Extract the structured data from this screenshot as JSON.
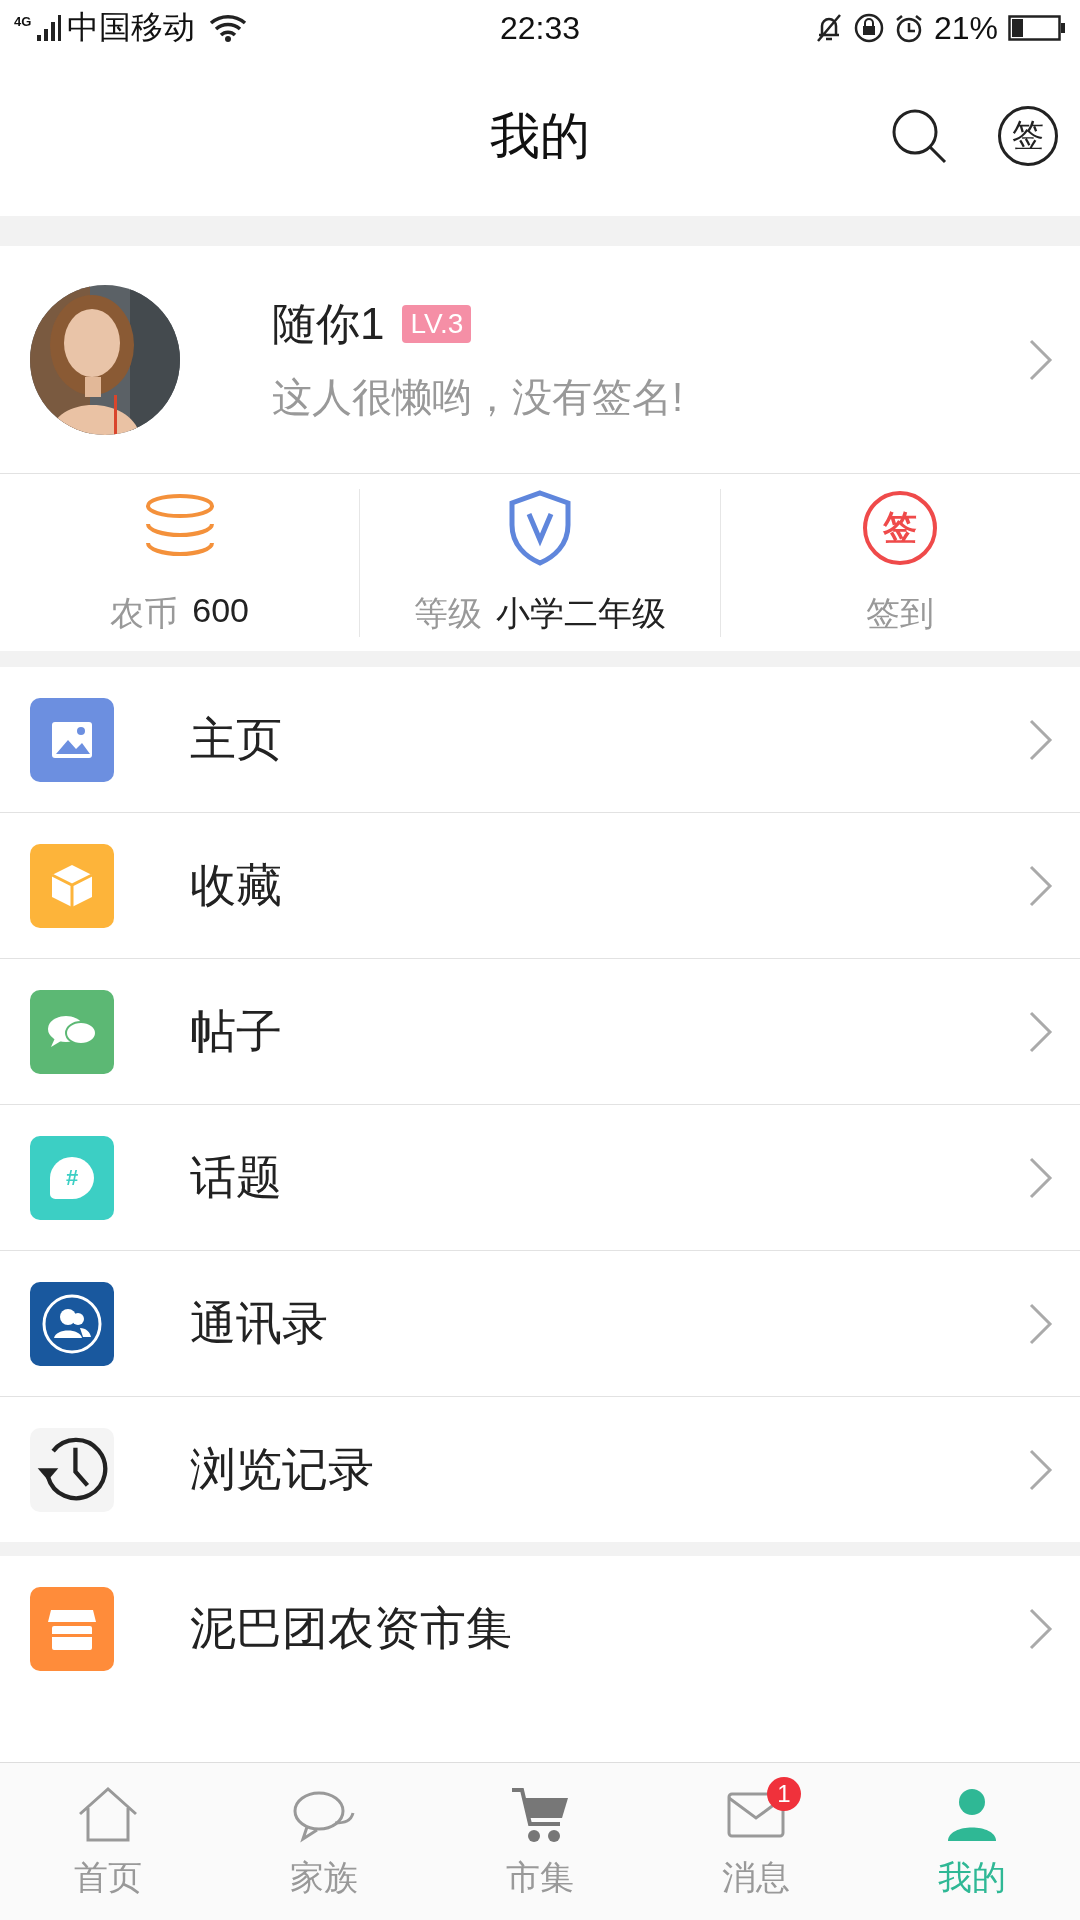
{
  "status_bar": {
    "network": "4G",
    "carrier": "中国移动",
    "time": "22:33",
    "battery": "21%"
  },
  "header": {
    "title": "我的",
    "sign_glyph": "签"
  },
  "profile": {
    "name": "随你1",
    "level_badge": "LV.3",
    "signature": "这人很懒哟，没有签名!"
  },
  "stats": [
    {
      "kind": "coins",
      "label": "农币",
      "value": "600"
    },
    {
      "kind": "grade",
      "label": "等级",
      "value": "小学二年级"
    },
    {
      "kind": "sign",
      "label": "签到",
      "glyph": "签"
    }
  ],
  "menu_groups": [
    {
      "items": [
        {
          "label": "主页"
        },
        {
          "label": "收藏"
        },
        {
          "label": "帖子"
        },
        {
          "label": "话题",
          "glyph": "#"
        },
        {
          "label": "通讯录"
        },
        {
          "label": "浏览记录"
        }
      ]
    },
    {
      "items": [
        {
          "label": "泥巴团农资市集"
        }
      ]
    }
  ],
  "tab_bar": [
    {
      "label": "首页",
      "selected": false
    },
    {
      "label": "家族",
      "selected": false
    },
    {
      "label": "市集",
      "selected": false
    },
    {
      "label": "消息",
      "selected": false,
      "badge": "1"
    },
    {
      "label": "我的",
      "selected": true
    }
  ]
}
